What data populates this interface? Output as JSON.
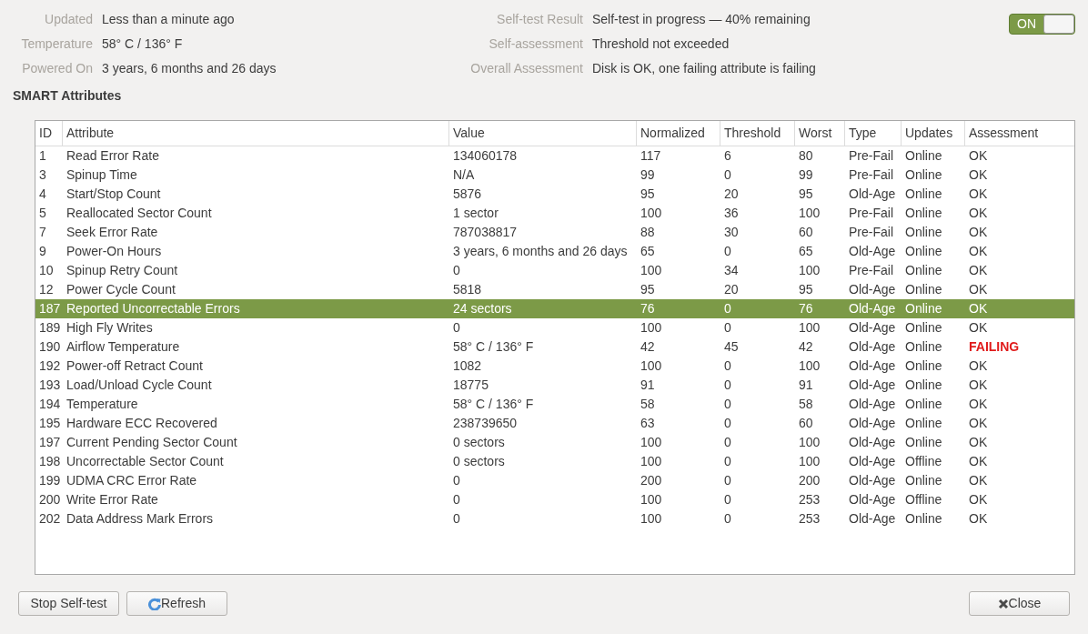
{
  "info_left": [
    {
      "label": "Updated",
      "value": "Less than a minute ago"
    },
    {
      "label": "Temperature",
      "value": "58° C / 136° F"
    },
    {
      "label": "Powered On",
      "value": "3 years, 6 months and 26 days"
    }
  ],
  "info_right": [
    {
      "label": "Self-test Result",
      "value": "Self-test in progress — 40% remaining"
    },
    {
      "label": "Self-assessment",
      "value": "Threshold not exceeded"
    },
    {
      "label": "Overall Assessment",
      "value": "Disk is OK, one failing attribute is failing"
    }
  ],
  "toggle": {
    "label": "ON",
    "on": true
  },
  "section_title": "SMART Attributes",
  "table": {
    "columns": [
      "ID",
      "Attribute",
      "Value",
      "Normalized",
      "Threshold",
      "Worst",
      "Type",
      "Updates",
      "Assessment"
    ],
    "rows": [
      {
        "cells": [
          "1",
          "Read Error Rate",
          "134060178",
          "117",
          "6",
          "80",
          "Pre-Fail",
          "Online",
          "OK"
        ],
        "selected": false,
        "failing": false
      },
      {
        "cells": [
          "3",
          "Spinup Time",
          "N/A",
          "99",
          "0",
          "99",
          "Pre-Fail",
          "Online",
          "OK"
        ],
        "selected": false,
        "failing": false
      },
      {
        "cells": [
          "4",
          "Start/Stop Count",
          "5876",
          "95",
          "20",
          "95",
          "Old-Age",
          "Online",
          "OK"
        ],
        "selected": false,
        "failing": false
      },
      {
        "cells": [
          "5",
          "Reallocated Sector Count",
          "1 sector",
          "100",
          "36",
          "100",
          "Pre-Fail",
          "Online",
          "OK"
        ],
        "selected": false,
        "failing": false
      },
      {
        "cells": [
          "7",
          "Seek Error Rate",
          "787038817",
          "88",
          "30",
          "60",
          "Pre-Fail",
          "Online",
          "OK"
        ],
        "selected": false,
        "failing": false
      },
      {
        "cells": [
          "9",
          "Power-On Hours",
          "3 years, 6 months and 26 days",
          "65",
          "0",
          "65",
          "Old-Age",
          "Online",
          "OK"
        ],
        "selected": false,
        "failing": false
      },
      {
        "cells": [
          "10",
          "Spinup Retry Count",
          "0",
          "100",
          "34",
          "100",
          "Pre-Fail",
          "Online",
          "OK"
        ],
        "selected": false,
        "failing": false
      },
      {
        "cells": [
          "12",
          "Power Cycle Count",
          "5818",
          "95",
          "20",
          "95",
          "Old-Age",
          "Online",
          "OK"
        ],
        "selected": false,
        "failing": false
      },
      {
        "cells": [
          "187",
          "Reported Uncorrectable Errors",
          "24 sectors",
          "76",
          "0",
          "76",
          "Old-Age",
          "Online",
          "OK"
        ],
        "selected": true,
        "failing": false
      },
      {
        "cells": [
          "189",
          "High Fly Writes",
          "0",
          "100",
          "0",
          "100",
          "Old-Age",
          "Online",
          "OK"
        ],
        "selected": false,
        "failing": false
      },
      {
        "cells": [
          "190",
          "Airflow Temperature",
          "58° C / 136° F",
          "42",
          "45",
          "42",
          "Old-Age",
          "Online",
          "FAILING"
        ],
        "selected": false,
        "failing": true
      },
      {
        "cells": [
          "192",
          "Power-off Retract Count",
          "1082",
          "100",
          "0",
          "100",
          "Old-Age",
          "Online",
          "OK"
        ],
        "selected": false,
        "failing": false
      },
      {
        "cells": [
          "193",
          "Load/Unload Cycle Count",
          "18775",
          "91",
          "0",
          "91",
          "Old-Age",
          "Online",
          "OK"
        ],
        "selected": false,
        "failing": false
      },
      {
        "cells": [
          "194",
          "Temperature",
          "58° C / 136° F",
          "58",
          "0",
          "58",
          "Old-Age",
          "Online",
          "OK"
        ],
        "selected": false,
        "failing": false
      },
      {
        "cells": [
          "195",
          "Hardware ECC Recovered",
          "238739650",
          "63",
          "0",
          "60",
          "Old-Age",
          "Online",
          "OK"
        ],
        "selected": false,
        "failing": false
      },
      {
        "cells": [
          "197",
          "Current Pending Sector Count",
          "0 sectors",
          "100",
          "0",
          "100",
          "Old-Age",
          "Online",
          "OK"
        ],
        "selected": false,
        "failing": false
      },
      {
        "cells": [
          "198",
          "Uncorrectable Sector Count",
          "0 sectors",
          "100",
          "0",
          "100",
          "Old-Age",
          "Offline",
          "OK"
        ],
        "selected": false,
        "failing": false
      },
      {
        "cells": [
          "199",
          "UDMA CRC Error Rate",
          "0",
          "200",
          "0",
          "200",
          "Old-Age",
          "Online",
          "OK"
        ],
        "selected": false,
        "failing": false
      },
      {
        "cells": [
          "200",
          "Write Error Rate",
          "0",
          "100",
          "0",
          "253",
          "Old-Age",
          "Offline",
          "OK"
        ],
        "selected": false,
        "failing": false
      },
      {
        "cells": [
          "202",
          "Data Address Mark Errors",
          "0",
          "100",
          "0",
          "253",
          "Old-Age",
          "Online",
          "OK"
        ],
        "selected": false,
        "failing": false
      }
    ]
  },
  "buttons": [
    {
      "label": "Stop Self-test",
      "kind": "plain"
    },
    {
      "label": "Refresh",
      "kind": "refresh"
    },
    {
      "label": "Close",
      "kind": "close"
    }
  ]
}
